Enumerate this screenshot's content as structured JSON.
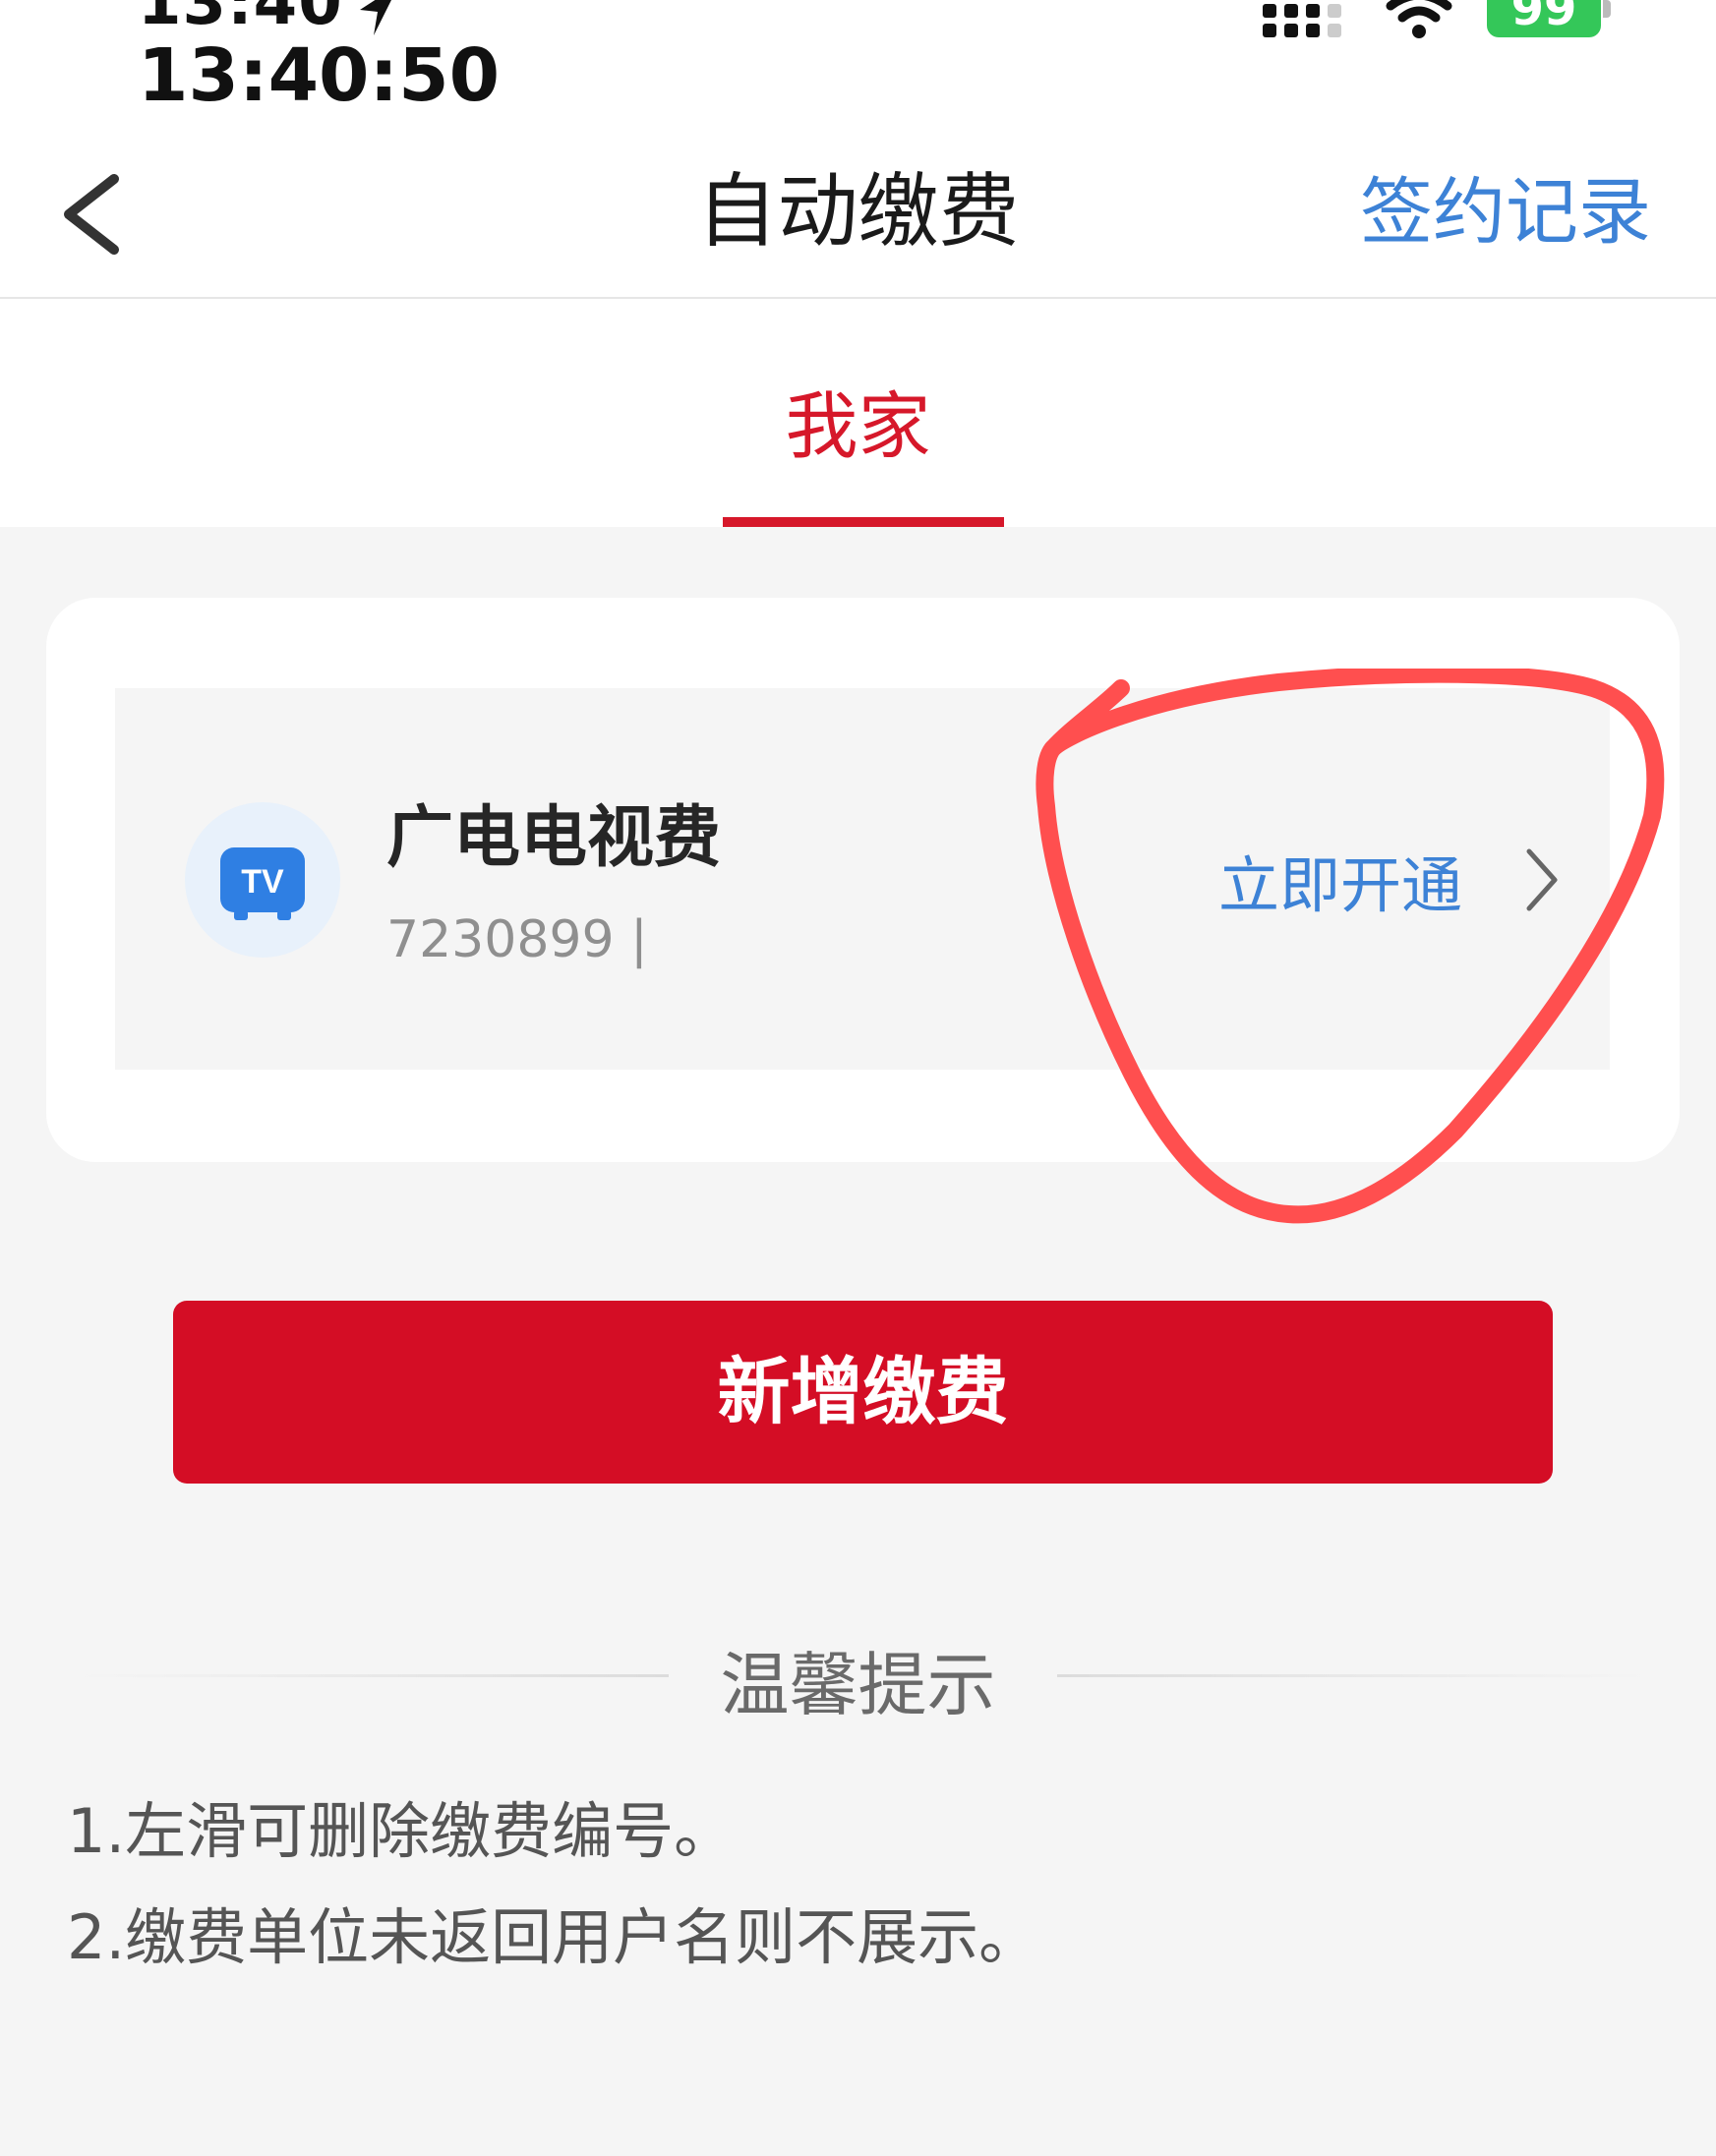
{
  "status_bar": {
    "time_partial": "13:40",
    "time_seconds": "13:40:50",
    "battery": "99"
  },
  "navbar": {
    "title": "自动缴费",
    "sign_record": "签约记录"
  },
  "tabs": [
    {
      "label": "我家"
    }
  ],
  "payment_card": {
    "service_name": "广电电视费",
    "account_number": "7230899 |",
    "action_label": "立即开通",
    "icon": "tv-icon"
  },
  "add_button": {
    "label": "新增缴费"
  },
  "tips": {
    "title": "温馨提示",
    "items": [
      "1.左滑可删除缴费编号。",
      "2.缴费单位未返回用户名则不展示。"
    ]
  },
  "colors": {
    "accent_red": "#d40d25",
    "link_blue": "#3d82d6",
    "annotation_red": "#ff4f4f"
  }
}
